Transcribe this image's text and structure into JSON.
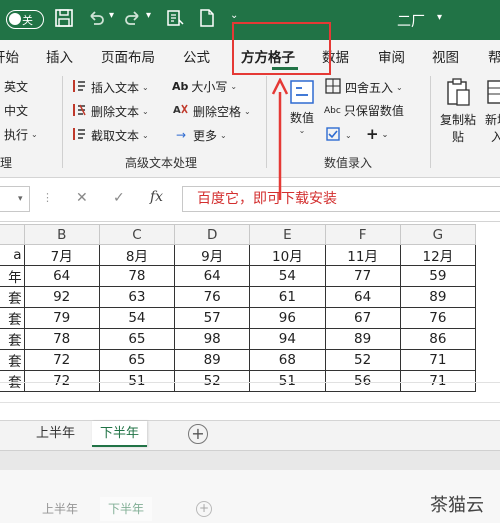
{
  "titlebar": {
    "autosave_label": "关",
    "title": "二厂",
    "user": "🔔"
  },
  "tabs": [
    {
      "label": "开始"
    },
    {
      "label": "插入"
    },
    {
      "label": "页面布局"
    },
    {
      "label": "公式"
    },
    {
      "label": "方方格子"
    },
    {
      "label": "数据"
    },
    {
      "label": "审阅"
    },
    {
      "label": "视图"
    },
    {
      "label": "帮"
    }
  ],
  "ribbon": {
    "col1": [
      "英文",
      "中文",
      "执行"
    ],
    "col2": [
      "插入文本",
      "删除文本",
      "截取文本"
    ],
    "col3": [
      "大小写",
      "删除空格",
      "更多"
    ],
    "col3_prefix": "Ab",
    "numeric_btn": "数值",
    "col4": [
      "四舍五入",
      "只保留数值"
    ],
    "col4_prefix": "Abc",
    "right_btn1_line1": "复制粘",
    "right_btn1_line2": "贴",
    "right_btn2_line1": "新增",
    "right_btn2_line2": "入",
    "group_labels": [
      "理",
      "高级文本处理",
      "数值录入"
    ],
    "ab_symbol": "Ab",
    "x_symbol": "✕",
    "plus_symbol": "+"
  },
  "formula_bar": {
    "name_box": "",
    "cancel": "✕",
    "enter": "✓",
    "fx": "fx",
    "content": "百度它，即可下载安装"
  },
  "sheet": {
    "columns": [
      "B",
      "C",
      "D",
      "E",
      "F",
      "G"
    ],
    "header_row": [
      "",
      "7月",
      "8月",
      "9月",
      "10月",
      "11月",
      "12月"
    ],
    "rows": [
      {
        "label": "年",
        "values": [
          "64",
          "78",
          "64",
          "54",
          "77",
          "59"
        ]
      },
      {
        "label": "套",
        "values": [
          "92",
          "63",
          "76",
          "61",
          "64",
          "89"
        ]
      },
      {
        "label": "套",
        "values": [
          "79",
          "54",
          "57",
          "96",
          "67",
          "76"
        ]
      },
      {
        "label": "套",
        "values": [
          "78",
          "65",
          "98",
          "94",
          "89",
          "86"
        ]
      },
      {
        "label": "套",
        "values": [
          "72",
          "65",
          "89",
          "68",
          "52",
          "71"
        ]
      },
      {
        "label": "套",
        "values": [
          "72",
          "51",
          "52",
          "51",
          "56",
          "71"
        ]
      }
    ],
    "first_col_header": "a"
  },
  "sheet_tabs": [
    {
      "label": "上半年",
      "active": false
    },
    {
      "label": "下半年",
      "active": true
    }
  ],
  "add_sheet": "+",
  "echo_tabs": [
    {
      "label": "上半年"
    },
    {
      "label": "下半年"
    }
  ],
  "watermark": "茶猫云",
  "colors": {
    "brand": "#217346",
    "annotation": "#e53935"
  }
}
